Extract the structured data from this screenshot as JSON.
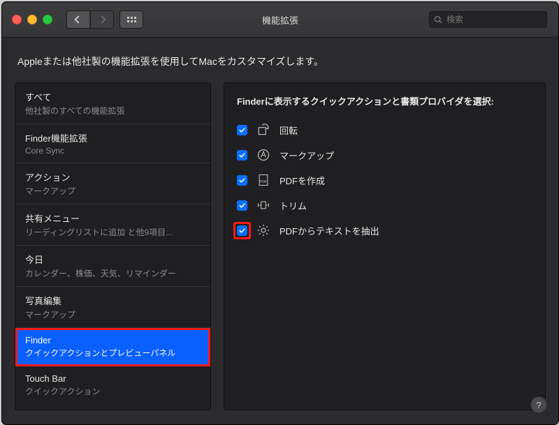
{
  "window": {
    "title": "機能拡張"
  },
  "search": {
    "placeholder": "検索"
  },
  "description": "Appleまたは他社製の機能拡張を使用してMacをカスタマイズします。",
  "sidebar": {
    "items": [
      {
        "title": "すべて",
        "sub": "他社製のすべての機能拡張",
        "selected": false,
        "highlighted": false
      },
      {
        "title": "Finder機能拡張",
        "sub": "Core Sync",
        "selected": false,
        "highlighted": false
      },
      {
        "title": "アクション",
        "sub": "マークアップ",
        "selected": false,
        "highlighted": false
      },
      {
        "title": "共有メニュー",
        "sub": "リーディングリストに追加 と他9項目...",
        "selected": false,
        "highlighted": false
      },
      {
        "title": "今日",
        "sub": "カレンダー、株価、天気、リマインダー",
        "selected": false,
        "highlighted": false
      },
      {
        "title": "写真編集",
        "sub": "マークアップ",
        "selected": false,
        "highlighted": false
      },
      {
        "title": "Finder",
        "sub": "クイックアクションとプレビューパネル",
        "selected": true,
        "highlighted": true
      },
      {
        "title": "Touch Bar",
        "sub": "クイックアクション",
        "selected": false,
        "highlighted": false
      }
    ]
  },
  "panel": {
    "heading": "Finderに表示するクイックアクションと書類プロバイダを選択:",
    "options": [
      {
        "label": "回転",
        "checked": true,
        "icon": "rotate-icon",
        "highlighted": false
      },
      {
        "label": "マークアップ",
        "checked": true,
        "icon": "markup-icon",
        "highlighted": false
      },
      {
        "label": "PDFを作成",
        "checked": true,
        "icon": "pdf-icon",
        "highlighted": false
      },
      {
        "label": "トリム",
        "checked": true,
        "icon": "trim-icon",
        "highlighted": false
      },
      {
        "label": "PDFからテキストを抽出",
        "checked": true,
        "icon": "gear-icon",
        "highlighted": true
      }
    ]
  },
  "help": {
    "label": "?"
  }
}
